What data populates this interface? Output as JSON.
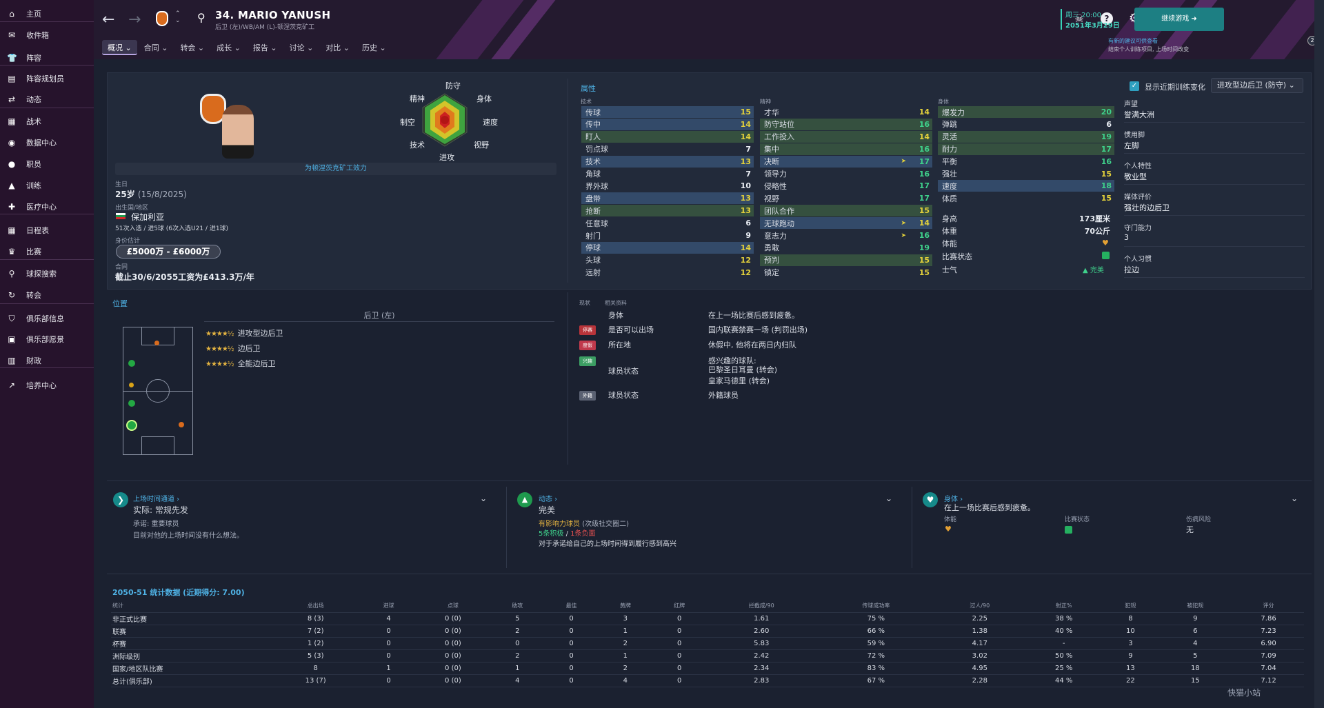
{
  "sidebar": {
    "items": [
      {
        "label": "主页",
        "icon": "home-icon"
      },
      {
        "label": "收件箱",
        "icon": "inbox-icon"
      },
      {
        "label": "阵容",
        "icon": "shirt-icon"
      },
      {
        "label": "阵容规划员",
        "icon": "clipboard-icon"
      },
      {
        "label": "动态",
        "icon": "dynamics-icon"
      },
      {
        "label": "战术",
        "icon": "tactics-icon"
      },
      {
        "label": "数据中心",
        "icon": "data-icon"
      },
      {
        "label": "职员",
        "icon": "staff-icon"
      },
      {
        "label": "训练",
        "icon": "training-icon"
      },
      {
        "label": "医疗中心",
        "icon": "medical-icon"
      },
      {
        "label": "日程表",
        "icon": "calendar-icon"
      },
      {
        "label": "比赛",
        "icon": "trophy-icon"
      },
      {
        "label": "球探搜索",
        "icon": "search-icon"
      },
      {
        "label": "转会",
        "icon": "transfer-icon"
      },
      {
        "label": "俱乐部信息",
        "icon": "shield-icon"
      },
      {
        "label": "俱乐部愿景",
        "icon": "vision-icon"
      },
      {
        "label": "财政",
        "icon": "finance-icon"
      },
      {
        "label": "培养中心",
        "icon": "development-icon"
      }
    ]
  },
  "header": {
    "title": "34. MARIO YANUSH",
    "subtitle": "后卫 (左)/WB/AM (L)-顿涅茨克矿工",
    "tabs": [
      "概况",
      "合同",
      "转会",
      "成长",
      "报告",
      "讨论",
      "对比",
      "历史"
    ],
    "date_day": "周三 20:00",
    "date": "2051年3月29日",
    "continue": "继续游戏",
    "notice_title": "有新的建议可供查看",
    "notice_body": "结束个人训练项目, 上场时间改变",
    "notice_count": "2"
  },
  "profile": {
    "club_text": "为顿涅茨克矿工效力",
    "birth_label": "生日",
    "birth_value": "25岁",
    "birth_date": "(15/8/2025)",
    "nation_label": "出生国/地区",
    "nation_value": "保加利亚",
    "caps": "51次入选 / 进5球 (6次入选U21 / 进1球)",
    "value_label": "身价估计",
    "value": "£5000万 - £6000万",
    "contract_label": "合同",
    "contract_value": "截止30/6/2055工资为£413.3万/年",
    "radar_labels": [
      "防守",
      "身体",
      "速度",
      "视野",
      "进攻",
      "技术",
      "制空",
      "精神"
    ]
  },
  "attributes": {
    "title": "属性",
    "tech_header": "技术",
    "mental_header": "精神",
    "physical_header": "身体",
    "technical": [
      {
        "n": "传球",
        "v": "15",
        "hl": "blue"
      },
      {
        "n": "传中",
        "v": "14",
        "hl": "blue"
      },
      {
        "n": "盯人",
        "v": "14",
        "hl": "green"
      },
      {
        "n": "罚点球",
        "v": "7",
        "hl": ""
      },
      {
        "n": "技术",
        "v": "13",
        "hl": "blue"
      },
      {
        "n": "角球",
        "v": "7",
        "hl": ""
      },
      {
        "n": "界外球",
        "v": "10",
        "hl": ""
      },
      {
        "n": "盘带",
        "v": "13",
        "hl": "blue"
      },
      {
        "n": "抢断",
        "v": "13",
        "hl": "green"
      },
      {
        "n": "任意球",
        "v": "6",
        "hl": ""
      },
      {
        "n": "射门",
        "v": "9",
        "hl": ""
      },
      {
        "n": "停球",
        "v": "14",
        "hl": "blue"
      },
      {
        "n": "头球",
        "v": "12",
        "hl": ""
      },
      {
        "n": "远射",
        "v": "12",
        "hl": ""
      }
    ],
    "mental": [
      {
        "n": "才华",
        "v": "14",
        "hl": ""
      },
      {
        "n": "防守站位",
        "v": "16",
        "hl": "green"
      },
      {
        "n": "工作投入",
        "v": "14",
        "hl": "green"
      },
      {
        "n": "集中",
        "v": "16",
        "hl": "green"
      },
      {
        "n": "决断",
        "v": "17",
        "hl": "blue"
      },
      {
        "n": "领导力",
        "v": "16",
        "hl": ""
      },
      {
        "n": "侵略性",
        "v": "17",
        "hl": ""
      },
      {
        "n": "视野",
        "v": "17",
        "hl": ""
      },
      {
        "n": "团队合作",
        "v": "15",
        "hl": "green"
      },
      {
        "n": "无球跑动",
        "v": "14",
        "hl": "blue"
      },
      {
        "n": "意志力",
        "v": "16",
        "hl": ""
      },
      {
        "n": "勇敢",
        "v": "19",
        "hl": ""
      },
      {
        "n": "预判",
        "v": "15",
        "hl": "green"
      },
      {
        "n": "镇定",
        "v": "15",
        "hl": ""
      }
    ],
    "physical": [
      {
        "n": "爆发力",
        "v": "20",
        "hl": "green"
      },
      {
        "n": "弹跳",
        "v": "6",
        "hl": ""
      },
      {
        "n": "灵活",
        "v": "19",
        "hl": "green"
      },
      {
        "n": "耐力",
        "v": "17",
        "hl": "green"
      },
      {
        "n": "平衡",
        "v": "16",
        "hl": ""
      },
      {
        "n": "强壮",
        "v": "15",
        "hl": ""
      },
      {
        "n": "速度",
        "v": "18",
        "hl": "blue"
      },
      {
        "n": "体质",
        "v": "15",
        "hl": ""
      }
    ],
    "height_label": "身高",
    "height": "173厘米",
    "weight_label": "体重",
    "weight": "70公斤",
    "fitness_label": "体能",
    "form_label": "比赛状态",
    "morale_label": "士气",
    "morale": "完美"
  },
  "right": {
    "show_training": "显示近期训练变化",
    "role_select": "进攻型边后卫 (防守)",
    "rep_label": "声望",
    "rep": "誉满大洲",
    "foot_label": "惯用脚",
    "foot": "左脚",
    "pers_label": "个人特性",
    "pers": "敬业型",
    "media_label": "媒体评价",
    "media": "强壮的边后卫",
    "goal_label": "守门能力",
    "goal": "3",
    "habit_label": "个人习惯",
    "habit": "拉边"
  },
  "position": {
    "title": "位置",
    "main": "后卫 (左)",
    "roles": [
      {
        "name": "进攻型边后卫",
        "stars": "★★★★½"
      },
      {
        "name": "边后卫",
        "stars": "★★★★½"
      },
      {
        "name": "全能边后卫",
        "stars": "★★★★½"
      }
    ]
  },
  "status": {
    "h1": "现状",
    "h2": "相关资料",
    "rows": [
      {
        "badge": "",
        "name": "身体",
        "text": "在上一场比赛后感到疲惫。"
      },
      {
        "badge": "停赛",
        "color": "#b8343a",
        "name": "是否可以出场",
        "text": "国内联赛禁赛一场 (判罚出场)"
      },
      {
        "badge": "度假",
        "color": "#c0394c",
        "name": "所在地",
        "text": "休假中, 他将在两日内归队"
      },
      {
        "badge": "兴趣",
        "color": "#3c9e63",
        "name": "球员状态",
        "text": "感兴趣的球队:"
      },
      {
        "badge": "外籍",
        "color": "#5a6172",
        "name": "球员状态",
        "text": "外籍球员"
      }
    ],
    "interest1": "巴黎圣日耳曼 (转会)",
    "interest2": "皇家马德里 (转会)"
  },
  "cards": {
    "c1_title": "上场时间通道",
    "c1_value": "实际: 常规先发",
    "c1_promise": "承诺: 重要球员",
    "c1_note": "目前对他的上场时间没有什么想法。",
    "c2_title": "动态",
    "c2_value": "完美",
    "c2_line1": "有影响力球员",
    "c2_line1b": "(次级社交圈二)",
    "c2_pos": "5条积极",
    "c2_sep": "/",
    "c2_neg": "1条负面",
    "c2_note": "对于承诺给自己的上场时间得到履行感到高兴",
    "c3_title": "身体",
    "c3_value": "在上一场比赛后感到疲惫。",
    "c3_a": "体能",
    "c3_b": "比赛状态",
    "c3_c": "伤病风险",
    "c3_c_val": "无"
  },
  "stats": {
    "title": "2050-51 统计数据",
    "subtitle": "(近期得分: 7.00)",
    "headers": [
      "统计",
      "总出场",
      "进球",
      "点球",
      "助攻",
      "最佳",
      "黄牌",
      "红牌",
      "拦截成/90",
      "传球成功率",
      "过人/90",
      "射正%",
      "犯规",
      "被犯规",
      "评分"
    ],
    "rows": [
      [
        "非正式比赛",
        "8 (3)",
        "4",
        "0 (0)",
        "5",
        "0",
        "3",
        "0",
        "1.61",
        "75 %",
        "2.25",
        "38 %",
        "8",
        "9",
        "7.86"
      ],
      [
        "联赛",
        "7 (2)",
        "0",
        "0 (0)",
        "2",
        "0",
        "1",
        "0",
        "2.60",
        "66 %",
        "1.38",
        "40 %",
        "10",
        "6",
        "7.23"
      ],
      [
        "杯赛",
        "1 (2)",
        "0",
        "0 (0)",
        "0",
        "0",
        "2",
        "0",
        "5.83",
        "59 %",
        "4.17",
        "-",
        "3",
        "4",
        "6.90"
      ],
      [
        "洲际级别",
        "5 (3)",
        "0",
        "0 (0)",
        "2",
        "0",
        "1",
        "0",
        "2.42",
        "72 %",
        "3.02",
        "50 %",
        "9",
        "5",
        "7.09"
      ],
      [
        "国家/地区队比赛",
        "8",
        "1",
        "0 (0)",
        "1",
        "0",
        "2",
        "0",
        "2.34",
        "83 %",
        "4.95",
        "25 %",
        "13",
        "18",
        "7.04"
      ],
      [
        "总计(俱乐部)",
        "13 (7)",
        "0",
        "0 (0)",
        "4",
        "0",
        "4",
        "0",
        "2.83",
        "67 %",
        "2.28",
        "44 %",
        "22",
        "15",
        "7.12"
      ]
    ]
  },
  "watermark": "快猫小站"
}
